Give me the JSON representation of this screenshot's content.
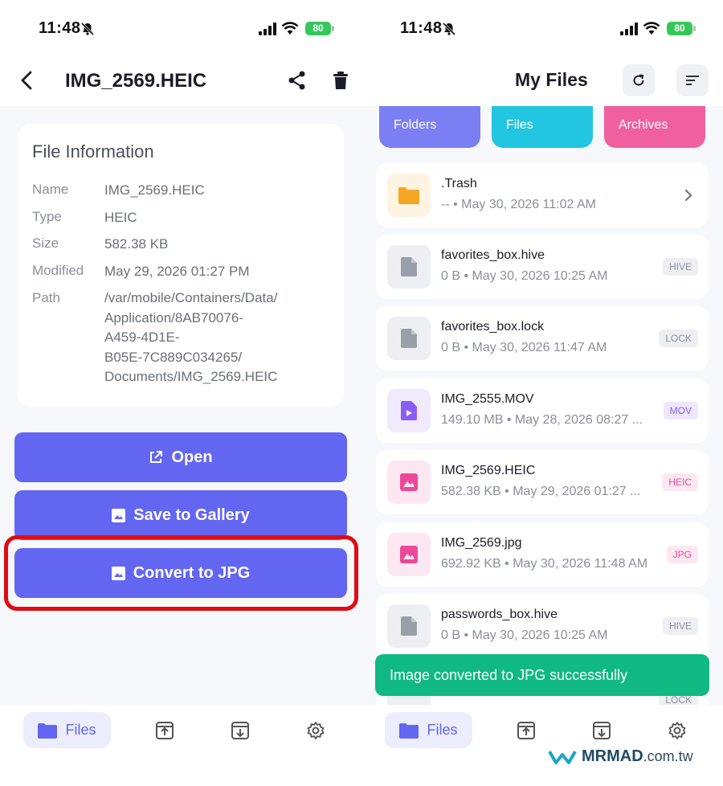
{
  "left": {
    "status": {
      "time": "11:48",
      "battery": "80"
    },
    "header": {
      "title": "IMG_2569.HEIC"
    },
    "info": {
      "title": "File Information",
      "rows": [
        {
          "label": "Name",
          "value": "IMG_2569.HEIC"
        },
        {
          "label": "Type",
          "value": "HEIC"
        },
        {
          "label": "Size",
          "value": "582.38 KB"
        },
        {
          "label": "Modified",
          "value": "May 29, 2026 01:27 PM"
        },
        {
          "label": "Path",
          "value": "/var/mobile/Containers/Data/\nApplication/8AB70076-\nA459-4D1E-\nB05E-7C889C034265/\nDocuments/IMG_2569.HEIC"
        }
      ]
    },
    "buttons": {
      "open": "Open",
      "save": "Save to Gallery",
      "convert": "Convert to JPG"
    },
    "nav": {
      "files": "Files"
    }
  },
  "right": {
    "status": {
      "time": "11:48",
      "battery": "80"
    },
    "header": {
      "title": "My Files"
    },
    "stats": [
      {
        "label": "Folders",
        "color": "#7b7ff3"
      },
      {
        "label": "Files",
        "color": "#22c6e0"
      },
      {
        "label": "Archives",
        "color": "#f0609e"
      }
    ],
    "files": [
      {
        "name": ".Trash",
        "meta": "--  •  May 30, 2026 11:02 AM",
        "badge": "",
        "kind": "folder"
      },
      {
        "name": "favorites_box.hive",
        "meta": "0 B  •  May 30, 2026 10:25 AM",
        "badge": "HIVE",
        "kind": "doc"
      },
      {
        "name": "favorites_box.lock",
        "meta": "0 B  •  May 30, 2026 11:47 AM",
        "badge": "LOCK",
        "kind": "doc"
      },
      {
        "name": "IMG_2555.MOV",
        "meta": "149.10 MB  •  May 28, 2026 08:27 ...",
        "badge": "MOV",
        "kind": "video"
      },
      {
        "name": "IMG_2569.HEIC",
        "meta": "582.38 KB  •  May 29, 2026 01:27 ...",
        "badge": "HEIC",
        "kind": "image"
      },
      {
        "name": "IMG_2569.jpg",
        "meta": "692.92 KB  •  May 30, 2026 11:48 AM",
        "badge": "JPG",
        "kind": "image"
      },
      {
        "name": "passwords_box.hive",
        "meta": "0 B  •  May 30, 2026 10:25 AM",
        "badge": "HIVE",
        "kind": "doc"
      }
    ],
    "partial_badge": "LOCK",
    "toast": "Image converted to JPG successfully",
    "nav": {
      "files": "Files"
    }
  },
  "watermark": {
    "brand": "MRMAD",
    "domain": ".com.tw"
  },
  "colors": {
    "accent": "#6366f1",
    "success": "#10b981",
    "highlight": "#e00b13"
  }
}
